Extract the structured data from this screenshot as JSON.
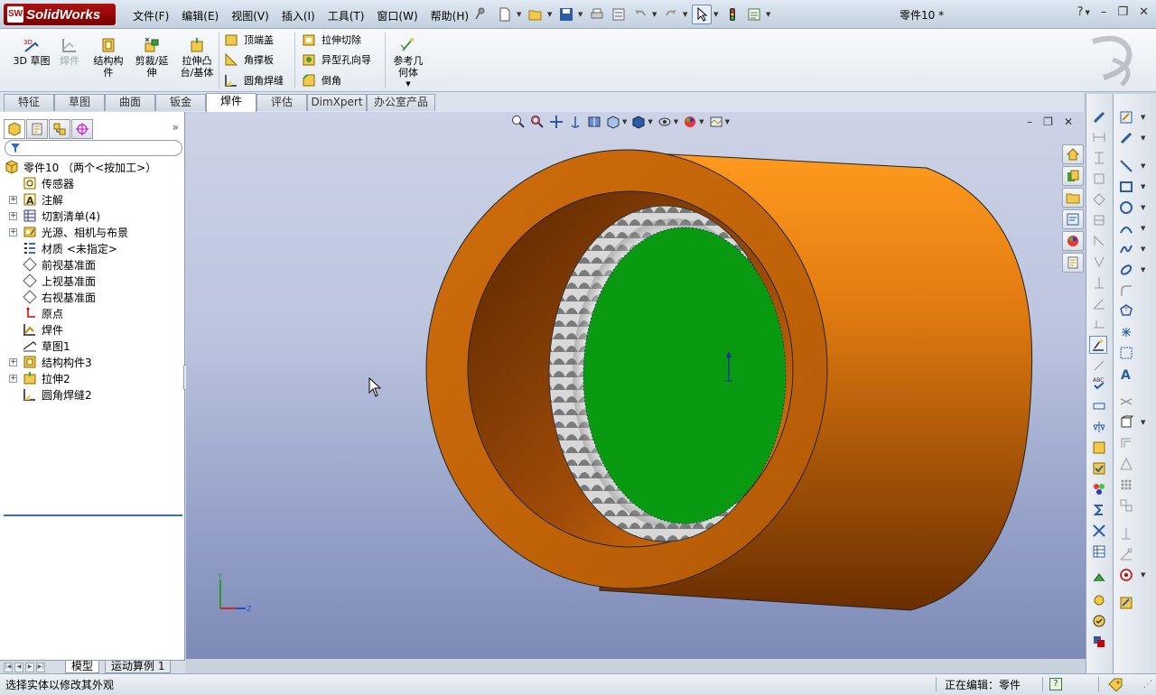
{
  "app": {
    "brand": "SolidWorks",
    "document_title": "零件10 *"
  },
  "menu": [
    "文件(F)",
    "编辑(E)",
    "视图(V)",
    "插入(I)",
    "工具(T)",
    "窗口(W)",
    "帮助(H)"
  ],
  "window_controls": {
    "help": "?",
    "minimize": "–",
    "restore": "❐",
    "close": "✕"
  },
  "command_manager": {
    "big_buttons": [
      {
        "id": "sketch3d",
        "label_line1": "3D 草图",
        "label_line2": "",
        "icon": "3d-sketch-icon"
      },
      {
        "id": "weldment",
        "label_line1": "焊件",
        "label_line2": "",
        "icon": "weldment-icon"
      },
      {
        "id": "structural",
        "label_line1": "结构构",
        "label_line2": "件",
        "icon": "structural-member-icon"
      },
      {
        "id": "trim",
        "label_line1": "剪裁/延",
        "label_line2": "伸",
        "icon": "trim-extend-icon"
      },
      {
        "id": "extrude",
        "label_line1": "拉伸凸",
        "label_line2": "台/基体",
        "icon": "extruded-boss-icon"
      },
      {
        "id": "refgeom",
        "label_line1": "参考几",
        "label_line2": "何体",
        "icon": "reference-geometry-icon"
      }
    ],
    "small_buttons_col1": [
      "顶端盖",
      "角撑板",
      "圆角焊缝"
    ],
    "small_buttons_col2": [
      "拉伸切除",
      "异型孔向导",
      "倒角"
    ]
  },
  "cmd_tabs": [
    "特征",
    "草图",
    "曲面",
    "钣金",
    "焊件",
    "评估",
    "DimXpert",
    "办公室产品"
  ],
  "active_cmd_tab": "焊件",
  "feature_tree": {
    "expand_symbol": "»",
    "nodes": [
      {
        "label": "零件10  （两个<按加工>）",
        "level": 0,
        "expandable": false,
        "icon": "part-icon"
      },
      {
        "label": "传感器",
        "level": 1,
        "expandable": false,
        "icon": "sensor-icon"
      },
      {
        "label": "注解",
        "level": 1,
        "expandable": true,
        "icon": "annotation-icon"
      },
      {
        "label": "切割清单(4)",
        "level": 1,
        "expandable": true,
        "icon": "cut-list-icon"
      },
      {
        "label": "光源、相机与布景",
        "level": 1,
        "expandable": true,
        "icon": "lights-cameras-icon"
      },
      {
        "label": "材质 <未指定>",
        "level": 1,
        "expandable": false,
        "icon": "material-icon"
      },
      {
        "label": "前视基准面",
        "level": 1,
        "expandable": false,
        "icon": "plane-icon"
      },
      {
        "label": "上视基准面",
        "level": 1,
        "expandable": false,
        "icon": "plane-icon"
      },
      {
        "label": "右视基准面",
        "level": 1,
        "expandable": false,
        "icon": "plane-icon"
      },
      {
        "label": "原点",
        "level": 1,
        "expandable": false,
        "icon": "origin-icon"
      },
      {
        "label": "焊件",
        "level": 1,
        "expandable": false,
        "icon": "weldment-icon"
      },
      {
        "label": "草图1",
        "level": 1,
        "expandable": false,
        "icon": "sketch-icon"
      },
      {
        "label": "结构构件3",
        "level": 1,
        "expandable": true,
        "icon": "structural-member-icon"
      },
      {
        "label": "拉伸2",
        "level": 1,
        "expandable": true,
        "icon": "extrude-icon"
      },
      {
        "label": "圆角焊缝2",
        "level": 1,
        "expandable": false,
        "icon": "fillet-bead-icon"
      }
    ]
  },
  "bottom_tabs": [
    "模型",
    "运动算例 1"
  ],
  "status": {
    "hint": "选择实体以修改其外观",
    "editing": "正在编辑：零件"
  },
  "triad": {
    "y": "Y",
    "z": "Z"
  },
  "colors": {
    "pipe_orange": "#e07a10",
    "pipe_shadow": "#8a3e00",
    "green_face": "#0a9a12",
    "brand_red": "#b01010"
  }
}
